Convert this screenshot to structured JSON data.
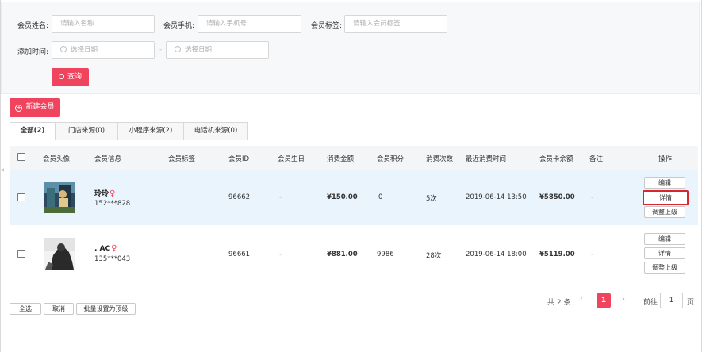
{
  "filters": {
    "name_label": "会员姓名:",
    "name_placeholder": "请输入名称",
    "phone_label": "会员手机:",
    "phone_placeholder": "请输入手机号",
    "tag_label": "会员标签:",
    "tag_placeholder": "请输入会员标签",
    "date_label": "添加时间:",
    "date_start_placeholder": "选择日期",
    "date_separator": "-",
    "date_end_placeholder": "选择日期",
    "search_button": "查询"
  },
  "new_member_button": "新建会员",
  "tabs": [
    {
      "label": "全部(2)",
      "active": true
    },
    {
      "label": "门店来源(0)",
      "active": false
    },
    {
      "label": "小程序来源(2)",
      "active": false
    },
    {
      "label": "电话机来源(0)",
      "active": false
    }
  ],
  "table": {
    "headers": {
      "avatar": "会员头像",
      "info": "会员信息",
      "tag": "会员标签",
      "id": "会员ID",
      "birthday": "会员生日",
      "amount": "消费金额",
      "points": "会员积分",
      "count": "消费次数",
      "last_time": "最近消费时间",
      "balance": "会员卡余额",
      "remark": "备注",
      "ops": "操作"
    },
    "rows": [
      {
        "name": "玲玲",
        "gender_symbol": "♀",
        "phone": "152***828",
        "tag": "",
        "id": "96662",
        "birthday": "-",
        "amount": "¥150.00",
        "points": "0",
        "count": "5次",
        "last_time": "2019-06-14 13:50",
        "balance": "¥5850.00",
        "remark": "-",
        "highlighted": true
      },
      {
        "name": ". AC",
        "gender_symbol": "♀",
        "phone": "135***043",
        "tag": "",
        "id": "96661",
        "birthday": "-",
        "amount": "¥881.00",
        "points": "9986",
        "count": "28次",
        "last_time": "2019-06-14 18:00",
        "balance": "¥5119.00",
        "remark": "-",
        "highlighted": false
      }
    ],
    "ops": {
      "edit": "编辑",
      "detail": "详情",
      "adjust": "调整上级"
    }
  },
  "footer": {
    "select_all": "全选",
    "cancel": "取消",
    "batch_top": "批量设置为顶级"
  },
  "pagination": {
    "total": "共 2 条",
    "prev": "‹",
    "current_page": "1",
    "next": "›",
    "goto_label": "前往",
    "goto_value": "1",
    "page_unit": "页"
  },
  "colors": {
    "accent": "#f0435e",
    "row_highlight": "#e9f4fd",
    "focus_border": "#d9252d"
  }
}
